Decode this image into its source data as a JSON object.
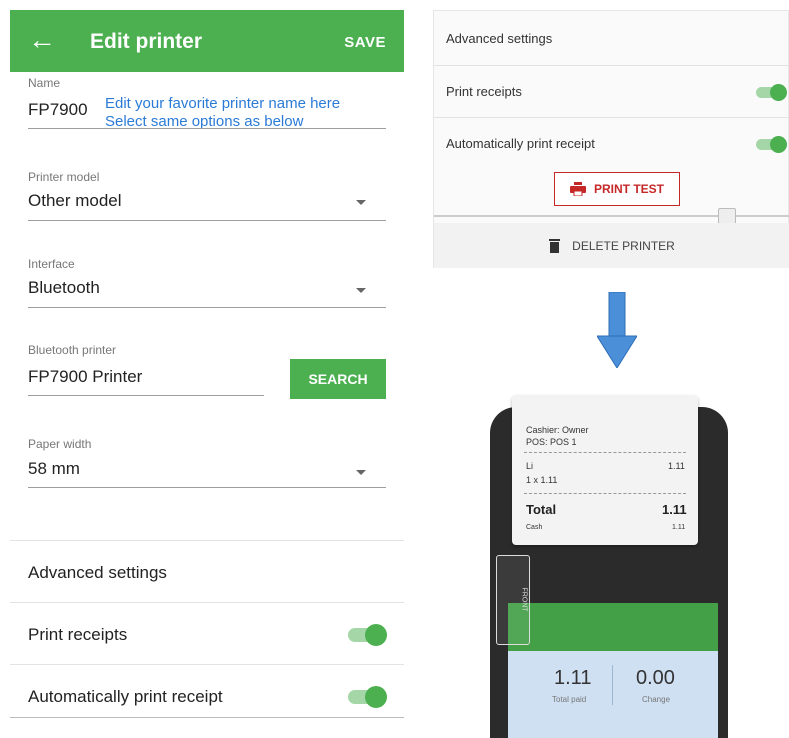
{
  "app_bar": {
    "title": "Edit printer",
    "save_label": "SAVE"
  },
  "form": {
    "name_label": "Name",
    "name_value": "FP7900",
    "hint_line1": "Edit your favorite printer name here",
    "hint_line2": "Select same options as below",
    "model_label": "Printer model",
    "model_value": "Other model",
    "interface_label": "Interface",
    "interface_value": "Bluetooth",
    "bt_label": "Bluetooth printer",
    "bt_value": "FP7900 Printer",
    "search_label": "SEARCH",
    "paper_label": "Paper width",
    "paper_value": "58 mm"
  },
  "settings": {
    "advanced": "Advanced settings",
    "print_receipts": "Print receipts",
    "print_receipts_on": true,
    "auto_print": "Automatically print receipt",
    "auto_print_on": true
  },
  "detail_panel": {
    "advanced": "Advanced settings",
    "print_receipts": "Print receipts",
    "auto_print": "Automatically print receipt",
    "print_test": "PRINT TEST",
    "delete_printer": "DELETE PRINTER"
  },
  "receipt": {
    "cashier": "Cashier: Owner",
    "pos": "POS: POS 1",
    "item": "Li",
    "item_price": "1.11",
    "qty": "1 x 1.11",
    "total_label": "Total",
    "total_value": "1.11",
    "cash_label": "Cash",
    "cash_value": "1.11",
    "clip_label": "FRONT"
  },
  "device_screen": {
    "total_paid": "1.11",
    "total_paid_label": "Total paid",
    "change": "0.00",
    "change_label": "Change"
  },
  "colors": {
    "accent": "#4caf50",
    "hint": "#2b7bd6",
    "danger": "#c62828",
    "arrow": "#4a8fd8"
  }
}
